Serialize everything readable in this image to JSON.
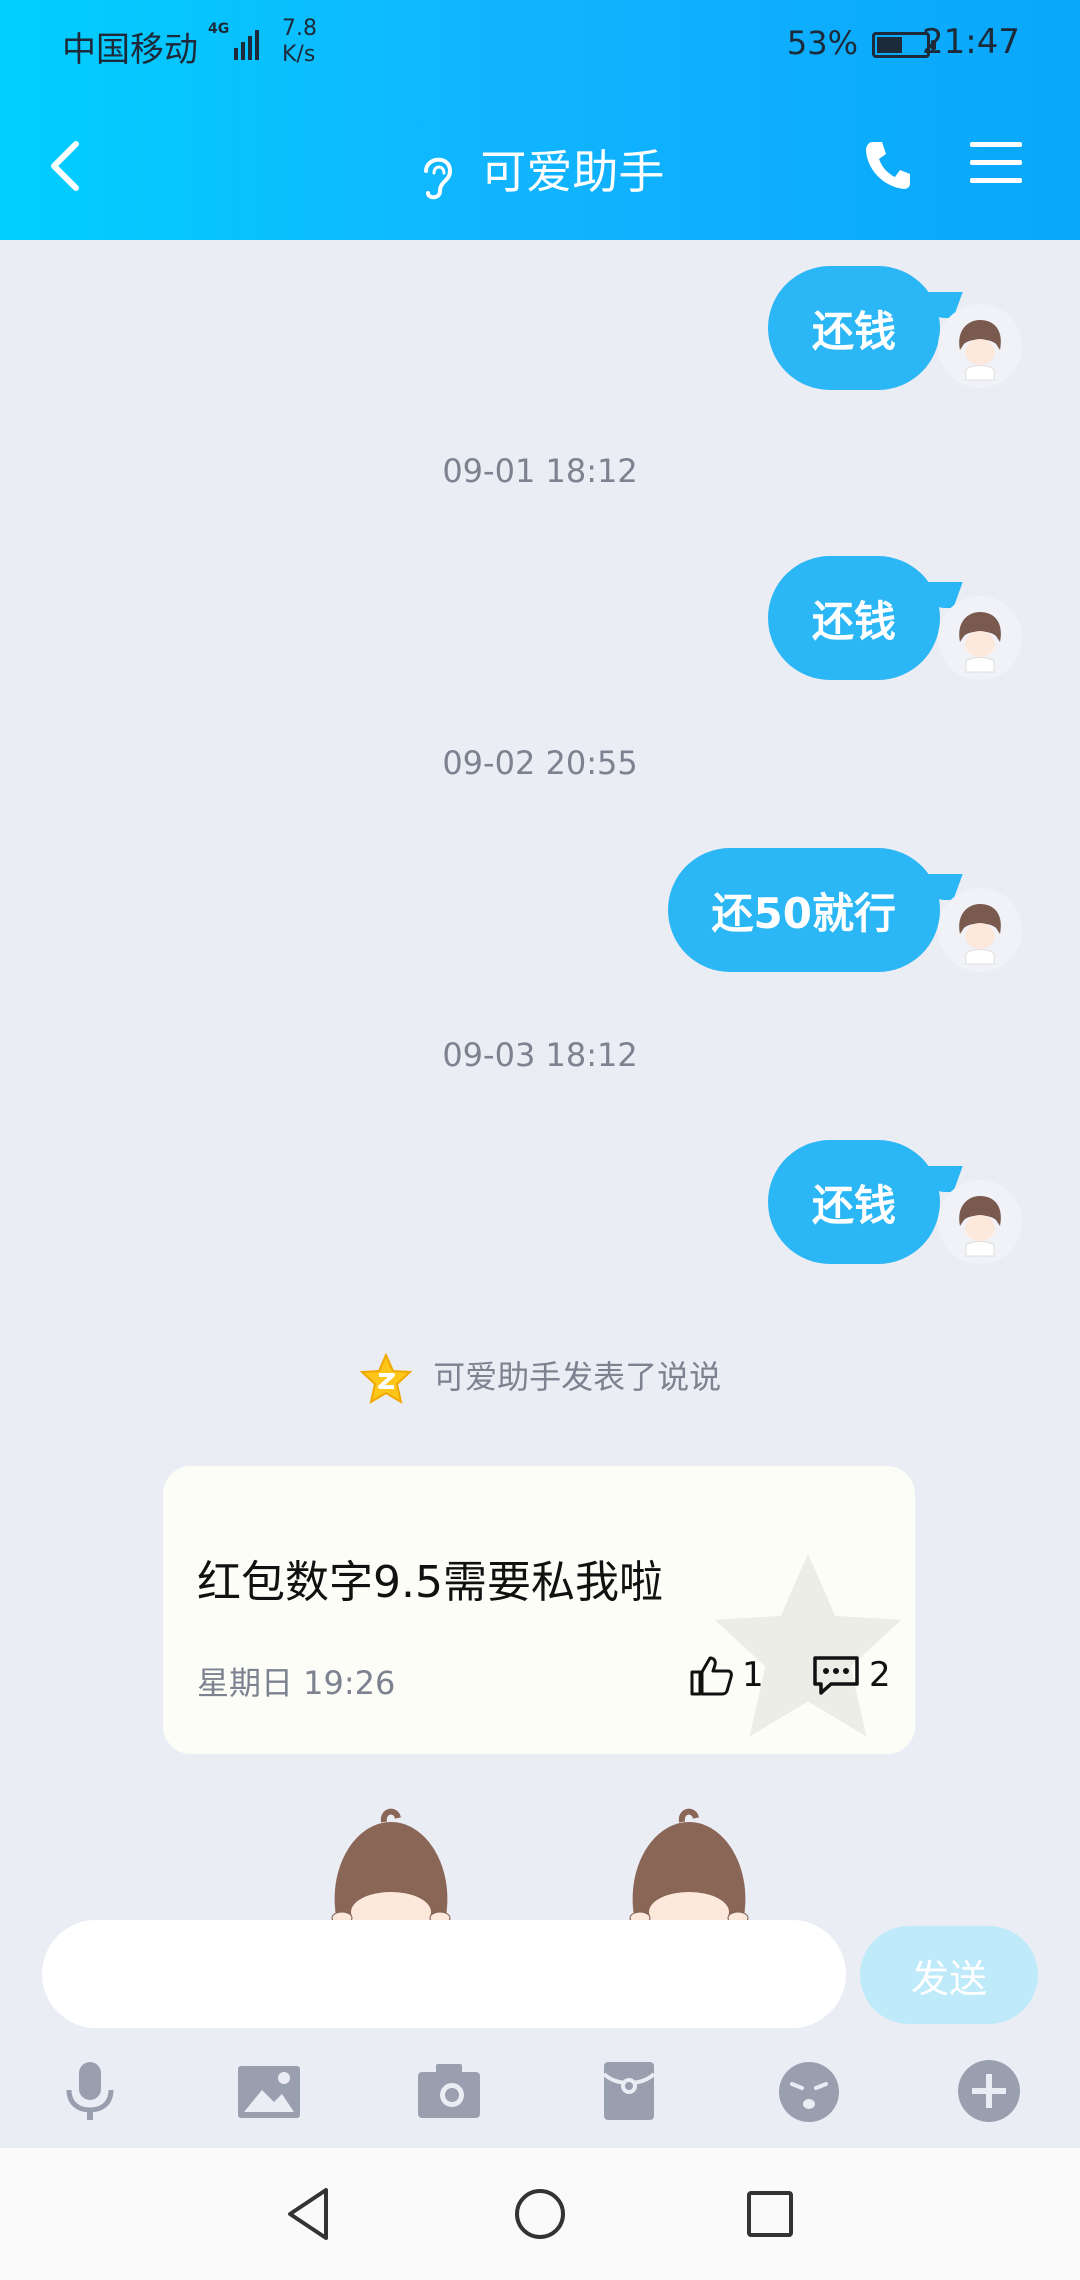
{
  "status_bar": {
    "carrier": "中国移动",
    "network": "4G",
    "speed_value": "7.8",
    "speed_unit": "K/s",
    "battery": "53%",
    "battery_level": 0.53,
    "time": "21:47"
  },
  "titlebar": {
    "title": "可爱助手",
    "icons": [
      "back-icon",
      "ear-icon",
      "phone-icon",
      "menu-icon"
    ]
  },
  "messages": [
    {
      "text": "还钱"
    },
    {
      "timestamp": "09-01 18:12",
      "text": "还钱"
    },
    {
      "timestamp": "09-02 20:55",
      "text": "还50就行"
    },
    {
      "timestamp": "09-03 18:12",
      "text": "还钱"
    }
  ],
  "notice": {
    "text": "可爱助手发表了说说",
    "icon": "qzone-star-icon"
  },
  "post_card": {
    "content": "红包数字9.5需要私我啦",
    "time": "星期日 19:26",
    "likes": "1",
    "comments": "2"
  },
  "input": {
    "placeholder": "",
    "send_label": "发送"
  },
  "toolbar": [
    "mic-icon",
    "image-icon",
    "camera-icon",
    "red-packet-icon",
    "emoji-icon",
    "plus-icon"
  ],
  "navbar": [
    "nav-back-icon",
    "nav-home-icon",
    "nav-recents-icon"
  ],
  "colors": {
    "header_start": "#00cfff",
    "header_end": "#0aa7fb",
    "bubble": "#2bb6f5",
    "background": "#ebedf5",
    "send_disabled": "#bfeafa"
  }
}
